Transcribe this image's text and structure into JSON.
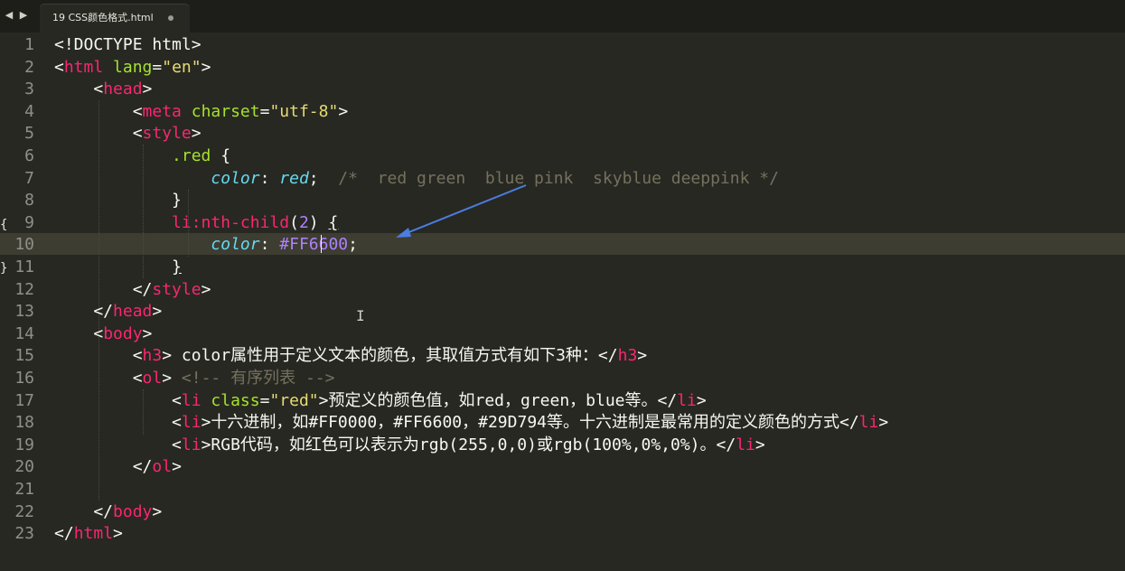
{
  "tab": {
    "title": "19 CSS颜色格式.html",
    "nav_left": "◀",
    "nav_right": "▶"
  },
  "editor": {
    "current_line": 10,
    "lines": [
      [
        [
          "t-txt",
          "<!DOCTYPE html>"
        ]
      ],
      [
        [
          "t-txt",
          "<"
        ],
        [
          "t-tag",
          "html"
        ],
        [
          "t-txt",
          " "
        ],
        [
          "t-attr",
          "lang"
        ],
        [
          "t-txt",
          "="
        ],
        [
          "t-str",
          "\"en\""
        ],
        [
          "t-txt",
          ">"
        ]
      ],
      [
        [
          "t-txt",
          "    <"
        ],
        [
          "t-tag",
          "head"
        ],
        [
          "t-txt",
          ">"
        ]
      ],
      [
        [
          "t-txt",
          "        <"
        ],
        [
          "t-tag",
          "meta"
        ],
        [
          "t-txt",
          " "
        ],
        [
          "t-attr",
          "charset"
        ],
        [
          "t-txt",
          "="
        ],
        [
          "t-str",
          "\"utf-8\""
        ],
        [
          "t-txt",
          ">"
        ]
      ],
      [
        [
          "t-txt",
          "        <"
        ],
        [
          "t-tag",
          "style"
        ],
        [
          "t-txt",
          ">"
        ]
      ],
      [
        [
          "t-txt",
          "            "
        ],
        [
          "t-sel",
          ".red"
        ],
        [
          "t-txt",
          " {"
        ]
      ],
      [
        [
          "t-txt",
          "                "
        ],
        [
          "t-prop",
          "color"
        ],
        [
          "t-txt",
          ": "
        ],
        [
          "t-prop",
          "red"
        ],
        [
          "t-txt",
          ";  "
        ],
        [
          "t-cmt",
          "/*  red green  blue pink  skyblue deeppink */"
        ]
      ],
      [
        [
          "t-txt",
          "            }"
        ]
      ],
      [
        [
          "t-txt",
          "            "
        ],
        [
          "t-pseudo",
          "li:nth-child"
        ],
        [
          "t-txt",
          "("
        ],
        [
          "t-num",
          "2"
        ],
        [
          "t-txt",
          ") "
        ],
        [
          "brace-match",
          "{"
        ]
      ],
      [
        [
          "t-txt",
          "                "
        ],
        [
          "t-prop",
          "color"
        ],
        [
          "t-txt",
          ": "
        ],
        [
          "t-num",
          "#FF6600"
        ],
        [
          "t-txt",
          ";"
        ]
      ],
      [
        [
          "t-txt",
          "            "
        ],
        [
          "brace-match",
          "}"
        ]
      ],
      [
        [
          "t-txt",
          "        </"
        ],
        [
          "t-tag",
          "style"
        ],
        [
          "t-txt",
          ">"
        ]
      ],
      [
        [
          "t-txt",
          "    </"
        ],
        [
          "t-tag",
          "head"
        ],
        [
          "t-txt",
          ">"
        ]
      ],
      [
        [
          "t-txt",
          "    <"
        ],
        [
          "t-tag",
          "body"
        ],
        [
          "t-txt",
          ">"
        ]
      ],
      [
        [
          "t-txt",
          "        <"
        ],
        [
          "t-tag",
          "h3"
        ],
        [
          "t-txt",
          "> color属性用于定义文本的颜色，其取值方式有如下3种：</"
        ],
        [
          "t-tag",
          "h3"
        ],
        [
          "t-txt",
          ">"
        ]
      ],
      [
        [
          "t-txt",
          "        <"
        ],
        [
          "t-tag",
          "ol"
        ],
        [
          "t-txt",
          "> "
        ],
        [
          "t-cmt",
          "<!-- 有序列表 -->"
        ]
      ],
      [
        [
          "t-txt",
          "            <"
        ],
        [
          "t-tag",
          "li"
        ],
        [
          "t-txt",
          " "
        ],
        [
          "t-attr",
          "class"
        ],
        [
          "t-txt",
          "="
        ],
        [
          "t-str",
          "\"red\""
        ],
        [
          "t-txt",
          ">预定义的颜色值，如red，green，blue等。</"
        ],
        [
          "t-tag",
          "li"
        ],
        [
          "t-txt",
          ">"
        ]
      ],
      [
        [
          "t-txt",
          "            <"
        ],
        [
          "t-tag",
          "li"
        ],
        [
          "t-txt",
          ">十六进制，如#FF0000，#FF6600，#29D794等。十六进制是最常用的定义颜色的方式</"
        ],
        [
          "t-tag",
          "li"
        ],
        [
          "t-txt",
          ">"
        ]
      ],
      [
        [
          "t-txt",
          "            <"
        ],
        [
          "t-tag",
          "li"
        ],
        [
          "t-txt",
          ">RGB代码，如红色可以表示为rgb(255,0,0)或rgb(100%,0%,0%)。</"
        ],
        [
          "t-tag",
          "li"
        ],
        [
          "t-txt",
          ">"
        ]
      ],
      [
        [
          "t-txt",
          "        </"
        ],
        [
          "t-tag",
          "ol"
        ],
        [
          "t-txt",
          ">"
        ]
      ],
      [
        [
          "t-txt",
          ""
        ]
      ],
      [
        [
          "t-txt",
          "    </"
        ],
        [
          "t-tag",
          "body"
        ],
        [
          "t-txt",
          ">"
        ]
      ],
      [
        [
          "t-txt",
          "</"
        ],
        [
          "t-tag",
          "html"
        ],
        [
          "t-txt",
          ">"
        ]
      ]
    ]
  }
}
